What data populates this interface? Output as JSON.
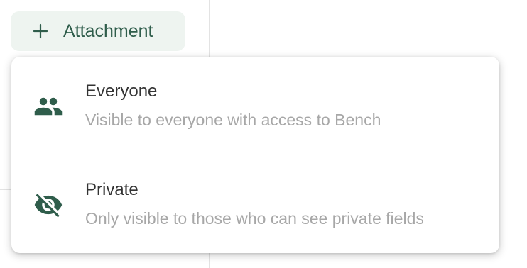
{
  "attachment_button": {
    "label": "Attachment",
    "icon": "plus-icon"
  },
  "visibility_menu": {
    "items": [
      {
        "title": "Everyone",
        "description": "Visible to everyone with access to Bench",
        "icon": "group-icon"
      },
      {
        "title": "Private",
        "description": "Only visible to those who can see private fields",
        "icon": "eye-off-icon"
      }
    ]
  },
  "colors": {
    "accent": "#2f5d4b",
    "button_background": "#eef4f0",
    "title_text": "#333333",
    "description_text": "#a7a7a7"
  }
}
